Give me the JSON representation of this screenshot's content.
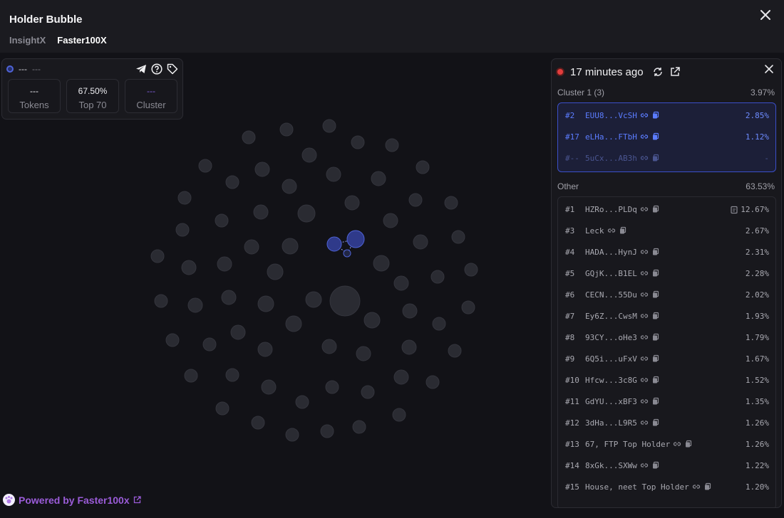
{
  "header": {
    "title": "Holder Bubble",
    "tabs": [
      {
        "label": "InsightX",
        "active": false
      },
      {
        "label": "Faster100X",
        "active": true
      }
    ]
  },
  "stats": {
    "name": "---",
    "sub": "---",
    "boxes": [
      {
        "value": "---",
        "label": "Tokens"
      },
      {
        "value": "67.50%",
        "label": "Top 70"
      },
      {
        "value": "---",
        "label": "Cluster"
      }
    ]
  },
  "panel": {
    "time": "17 minutes ago",
    "cluster": {
      "title": "Cluster 1 (3)",
      "pct": "3.97%",
      "rows": [
        {
          "rank": "#2",
          "addr": "EUU8...VcSH",
          "pct": "2.85%"
        },
        {
          "rank": "#17",
          "addr": "eLHa...FTbH",
          "pct": "1.12%"
        },
        {
          "rank": "#--",
          "addr": "5uCx...AB3h",
          "pct": "-"
        }
      ]
    },
    "other": {
      "title": "Other",
      "pct": "63.53%",
      "rows": [
        {
          "rank": "#1",
          "addr": "HZRo...PLDq",
          "pct": "12.67%",
          "link": true,
          "extra": true
        },
        {
          "rank": "#3",
          "addr": "Leck",
          "pct": "2.67%",
          "link": true
        },
        {
          "rank": "#4",
          "addr": "HADA...HynJ",
          "pct": "2.31%",
          "link": true
        },
        {
          "rank": "#5",
          "addr": "GQjK...B1EL",
          "pct": "2.28%",
          "link": true
        },
        {
          "rank": "#6",
          "addr": "CECN...55Du",
          "pct": "2.02%",
          "link": true
        },
        {
          "rank": "#7",
          "addr": "Ey6Z...CwsM",
          "pct": "1.93%",
          "link": true
        },
        {
          "rank": "#8",
          "addr": "93CY...oHe3",
          "pct": "1.79%",
          "link": true
        },
        {
          "rank": "#9",
          "addr": "6Q5i...uFxV",
          "pct": "1.67%",
          "link": true
        },
        {
          "rank": "#10",
          "addr": "Hfcw...3c8G",
          "pct": "1.52%",
          "link": true
        },
        {
          "rank": "#11",
          "addr": "GdYU...xBF3",
          "pct": "1.35%",
          "link": true
        },
        {
          "rank": "#12",
          "addr": "3dHa...L9R5",
          "pct": "1.26%",
          "link": true
        },
        {
          "rank": "#13",
          "addr": "67, FTP Top Holder",
          "pct": "1.26%",
          "link": true
        },
        {
          "rank": "#14",
          "addr": "8xGk...SXWw",
          "pct": "1.22%",
          "link": true
        },
        {
          "rank": "#15",
          "addr": "House, neet Top Holder",
          "pct": "1.20%",
          "link": true
        }
      ]
    }
  },
  "footer": {
    "label": "Powered by Faster100x"
  },
  "colors": {
    "bubble": "#2a2b32",
    "cluster_bubble": "#2f3a8a",
    "accent": "#4f63d6",
    "brand": "#9b5cd9"
  }
}
